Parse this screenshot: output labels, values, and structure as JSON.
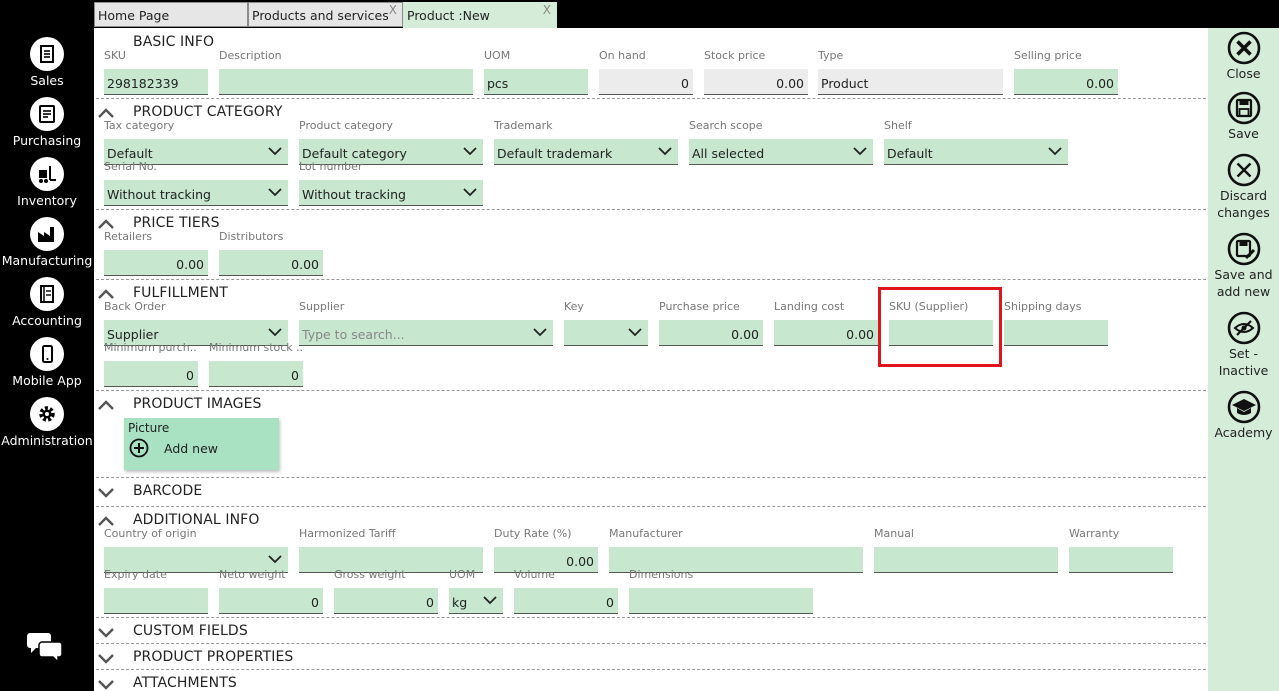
{
  "nav": [
    {
      "label": "Sales",
      "icon": "sales-document-icon"
    },
    {
      "label": "Purchasing",
      "icon": "purchasing-document-icon"
    },
    {
      "label": "Inventory",
      "icon": "forklift-icon"
    },
    {
      "label": "Manufacturing",
      "icon": "factory-icon"
    },
    {
      "label": "Accounting",
      "icon": "ledger-book-icon"
    },
    {
      "label": "Mobile App",
      "icon": "mobile-phone-icon"
    },
    {
      "label": "Administration",
      "icon": "gear-icon"
    }
  ],
  "tabs": [
    {
      "label": "Home Page"
    },
    {
      "label": "Products and services",
      "close": "X"
    },
    {
      "label": "Product :New",
      "close": "X"
    }
  ],
  "sections": {
    "basic_info": {
      "title": "BASIC INFO"
    },
    "product_category": {
      "title": "PRODUCT CATEGORY"
    },
    "price_tiers": {
      "title": "PRICE TIERS"
    },
    "fulfillment": {
      "title": "FULFILLMENT"
    },
    "product_images": {
      "title": "PRODUCT IMAGES"
    },
    "barcode": {
      "title": "BARCODE"
    },
    "additional_info": {
      "title": "ADDITIONAL INFO"
    },
    "custom_fields": {
      "title": "CUSTOM FIELDS"
    },
    "product_properties": {
      "title": "PRODUCT PROPERTIES"
    },
    "attachments": {
      "title": "ATTACHMENTS"
    }
  },
  "basic": {
    "sku": {
      "label": "SKU",
      "value": "298182339"
    },
    "description": {
      "label": "Description",
      "value": ""
    },
    "uom": {
      "label": "UOM",
      "value": "pcs"
    },
    "on_hand": {
      "label": "On hand",
      "value": "0"
    },
    "stock_price": {
      "label": "Stock price",
      "value": "0.00"
    },
    "type": {
      "label": "Type",
      "value": "Product"
    },
    "selling_price": {
      "label": "Selling price",
      "value": "0.00"
    }
  },
  "category": {
    "tax_category": {
      "label": "Tax category",
      "value": "Default"
    },
    "product_category": {
      "label": "Product category",
      "value": "Default category"
    },
    "trademark": {
      "label": "Trademark",
      "value": "Default trademark"
    },
    "search_scope": {
      "label": "Search scope",
      "value": "All selected"
    },
    "shelf": {
      "label": "Shelf",
      "value": "Default"
    },
    "serial_no": {
      "label": "Serial No.",
      "value": "Without tracking"
    },
    "lot_number": {
      "label": "Lot number",
      "value": "Without tracking"
    }
  },
  "price_tiers": {
    "retailers": {
      "label": "Retailers",
      "value": "0.00"
    },
    "distributors": {
      "label": "Distributors",
      "value": "0.00"
    }
  },
  "fulfillment": {
    "back_order": {
      "label": "Back Order",
      "value": "Supplier"
    },
    "supplier": {
      "label": "Supplier",
      "placeholder": "Type to search..."
    },
    "key": {
      "label": "Key",
      "value": ""
    },
    "purchase_price": {
      "label": "Purchase price",
      "value": "0.00"
    },
    "landing_cost": {
      "label": "Landing cost",
      "value": "0.00"
    },
    "sku_supplier": {
      "label": "SKU (Supplier)",
      "value": ""
    },
    "shipping_days": {
      "label": "Shipping days",
      "value": ""
    },
    "min_purchase": {
      "label": "Minimum purch...",
      "value": "0"
    },
    "min_stock": {
      "label": "Minimum stock ...",
      "value": "0"
    }
  },
  "images": {
    "picture_label": "Picture",
    "add_new_label": "Add new"
  },
  "additional": {
    "country": {
      "label": "Country of origin",
      "value": ""
    },
    "harmonized": {
      "label": "Harmonized Tariff",
      "value": ""
    },
    "duty_rate": {
      "label": "Duty Rate (%)",
      "value": "0.00"
    },
    "manufacturer": {
      "label": "Manufacturer",
      "value": ""
    },
    "manual": {
      "label": "Manual",
      "value": ""
    },
    "warranty": {
      "label": "Warranty",
      "value": ""
    },
    "expiry": {
      "label": "Expiry date",
      "value": ""
    },
    "neto_weight": {
      "label": "Neto weight",
      "value": "0"
    },
    "gross_weight": {
      "label": "Gross weight",
      "value": "0"
    },
    "uom": {
      "label": "UOM",
      "value": "kg"
    },
    "volume": {
      "label": "Volume",
      "value": "0"
    },
    "dimensions": {
      "label": "Dimensions",
      "value": ""
    }
  },
  "actions": {
    "close": {
      "line1": "Close",
      "line2": ""
    },
    "save": {
      "line1": "Save",
      "line2": ""
    },
    "discard": {
      "line1": "Discard",
      "line2": "changes"
    },
    "save_new": {
      "line1": "Save and",
      "line2": "add new"
    },
    "inactive": {
      "line1": "Set -",
      "line2": "Inactive"
    },
    "academy": {
      "line1": "Academy",
      "line2": ""
    }
  },
  "colors": {
    "field_bg": "#c7e7cf",
    "rail_bg": "#d5ecd9",
    "highlight": "#e0151b",
    "card_bg": "#a8e2c2"
  }
}
